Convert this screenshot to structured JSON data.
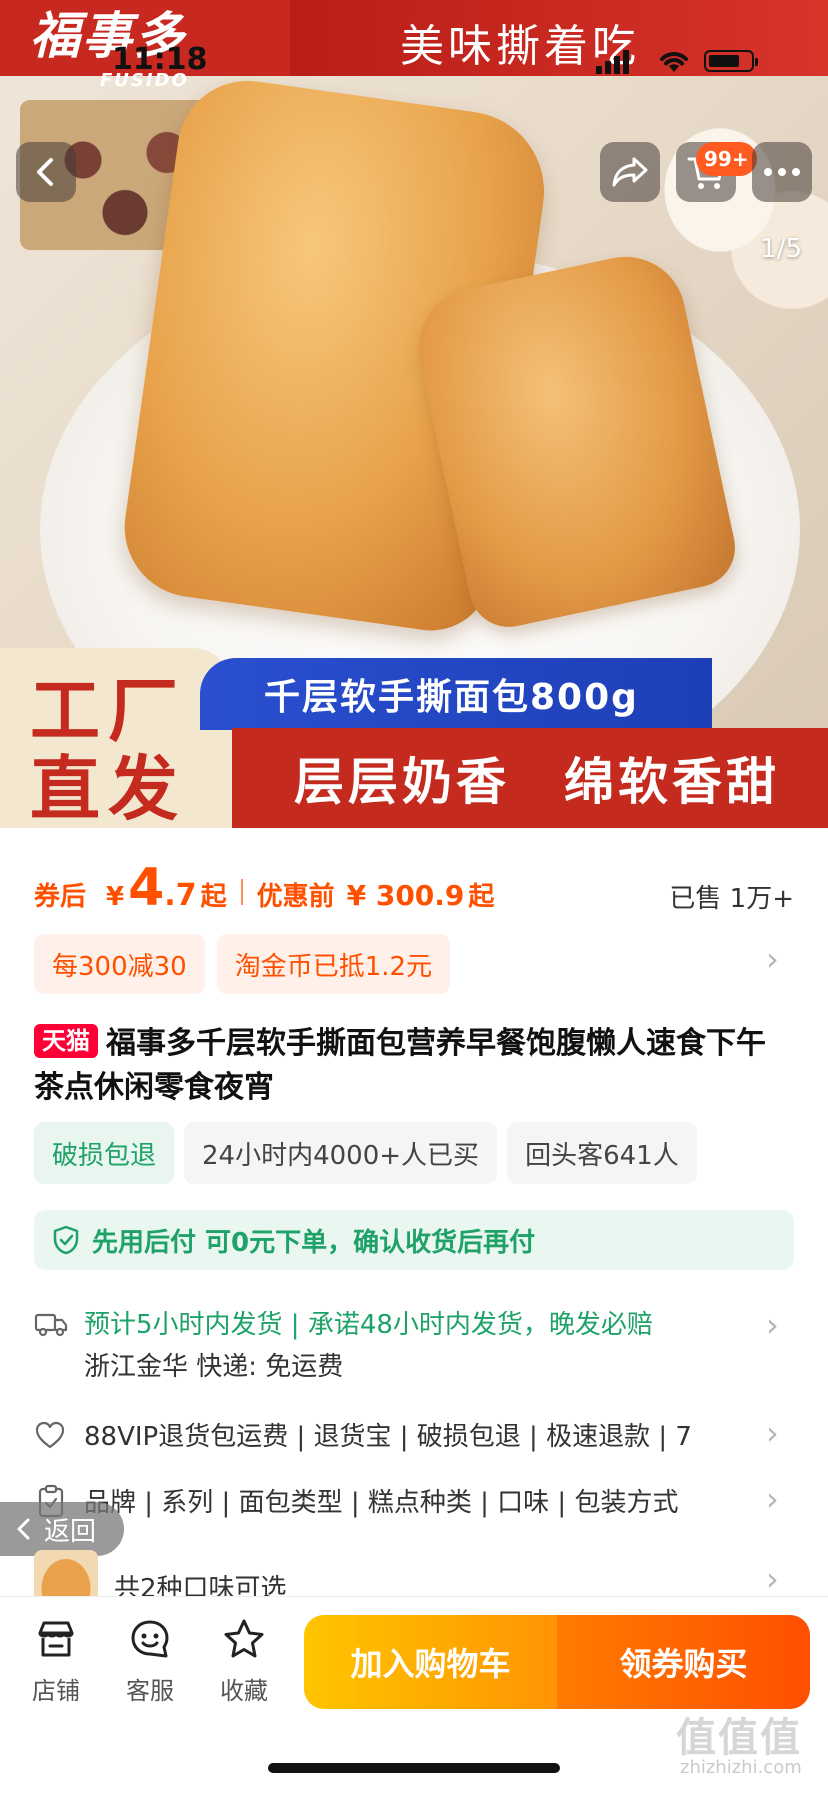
{
  "status_bar": {
    "time": "11:18"
  },
  "hero": {
    "brand_cn": "福事多",
    "brand_en": "FUSIDO",
    "slogan": "美味撕着吃",
    "cart_badge": "99+",
    "page_indicator": "1/5",
    "factory_text": "工厂直发",
    "product_chip": "千层软手撕面包800g",
    "feature_text": "层层奶香　绵软香甜"
  },
  "price": {
    "prefix": "券后",
    "yuan": "¥",
    "main": "4",
    "decimal": ".7",
    "suffix": "起",
    "orig_label": "优惠前",
    "orig_price": "¥ 300.9",
    "orig_suffix": "起",
    "sold": "已售 1万+"
  },
  "promos": [
    "每300减30",
    "淘金币已抵1.2元"
  ],
  "title": {
    "tag": "天猫",
    "text": "福事多千层软手撕面包营养早餐饱腹懒人速食下午茶点休闲零食夜宵"
  },
  "badges": [
    "破损包退",
    "24小时内4000+人已买",
    "回头客641人"
  ],
  "pay_later": "先用后付 可0元下单，确认收货后再付",
  "shipping": {
    "line1": "预计5小时内发货 | 承诺48小时内发货，晚发必赔",
    "line2": "浙江金华  快递: 免运费"
  },
  "services": "88VIP退货包运费 | 退货宝 | 破损包退 | 极速退款 | 7",
  "attributes": "品牌 | 系列 | 面包类型 | 糕点种类 | 口味 | 包装方式",
  "back_pill": "返回",
  "flavors": "共2种口味可选",
  "bottom_bar": {
    "store": "店铺",
    "service": "客服",
    "favorite": "收藏",
    "add_cart": "加入购物车",
    "buy": "领券购买"
  },
  "watermark": {
    "logo": "值值值",
    "url": "zhizhizhi.com"
  },
  "colors": {
    "accent": "#ff5000",
    "green": "#1ea268",
    "brand_red": "#c42a1e",
    "chip_blue": "#2a4fd0"
  }
}
